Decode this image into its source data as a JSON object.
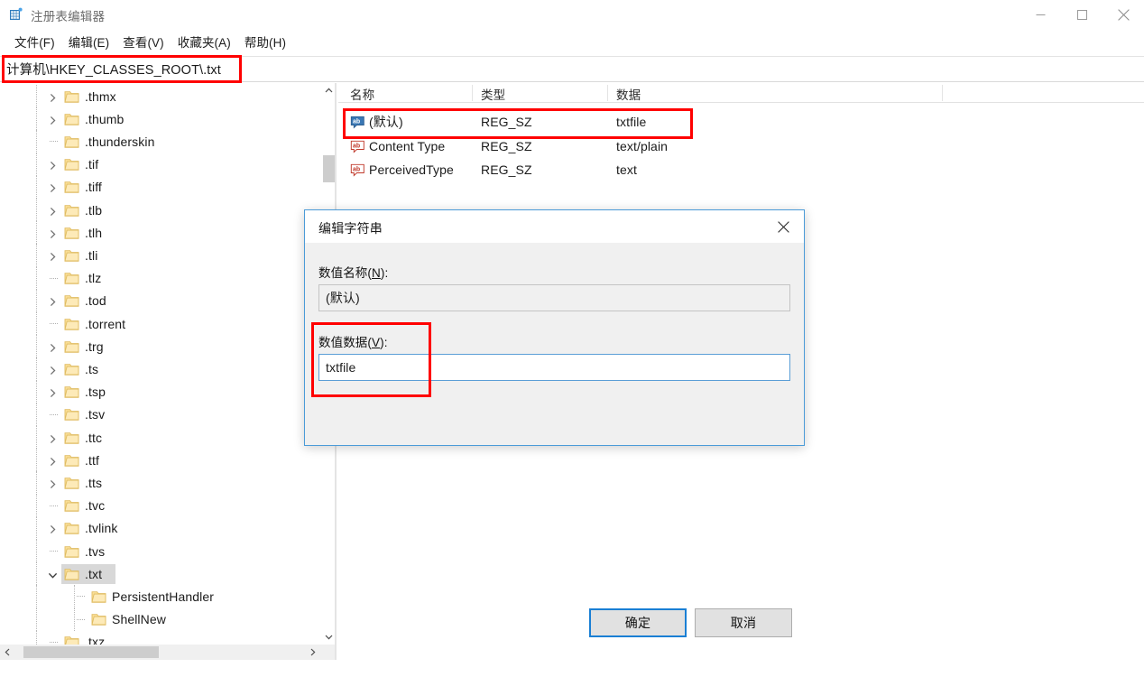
{
  "window": {
    "title": "注册表编辑器",
    "icon": "registry-editor-icon",
    "controls": {
      "minimize": "最小化",
      "maximize": "最大化",
      "close": "关闭"
    }
  },
  "menubar": {
    "items": [
      {
        "label": "文件(F)",
        "name": "menu-file"
      },
      {
        "label": "编辑(E)",
        "name": "menu-edit"
      },
      {
        "label": "查看(V)",
        "name": "menu-view"
      },
      {
        "label": "收藏夹(A)",
        "name": "menu-favorites"
      },
      {
        "label": "帮助(H)",
        "name": "menu-help"
      }
    ]
  },
  "address_bar": {
    "value": "计算机\\HKEY_CLASSES_ROOT\\.txt",
    "placeholder": "计算机\\HKEY_CLASSES_ROOT\\.txt"
  },
  "tree": {
    "items": [
      {
        "label": ".thmx",
        "expander": "collapsed",
        "depth": 1,
        "selected": false
      },
      {
        "label": ".thumb",
        "expander": "collapsed",
        "depth": 1,
        "selected": false
      },
      {
        "label": ".thunderskin",
        "expander": "leaf",
        "depth": 1,
        "selected": false
      },
      {
        "label": ".tif",
        "expander": "collapsed",
        "depth": 1,
        "selected": false
      },
      {
        "label": ".tiff",
        "expander": "collapsed",
        "depth": 1,
        "selected": false
      },
      {
        "label": ".tlb",
        "expander": "collapsed",
        "depth": 1,
        "selected": false
      },
      {
        "label": ".tlh",
        "expander": "collapsed",
        "depth": 1,
        "selected": false
      },
      {
        "label": ".tli",
        "expander": "collapsed",
        "depth": 1,
        "selected": false
      },
      {
        "label": ".tlz",
        "expander": "leaf",
        "depth": 1,
        "selected": false
      },
      {
        "label": ".tod",
        "expander": "collapsed",
        "depth": 1,
        "selected": false
      },
      {
        "label": ".torrent",
        "expander": "leaf",
        "depth": 1,
        "selected": false
      },
      {
        "label": ".trg",
        "expander": "collapsed",
        "depth": 1,
        "selected": false
      },
      {
        "label": ".ts",
        "expander": "collapsed",
        "depth": 1,
        "selected": false
      },
      {
        "label": ".tsp",
        "expander": "collapsed",
        "depth": 1,
        "selected": false
      },
      {
        "label": ".tsv",
        "expander": "leaf",
        "depth": 1,
        "selected": false
      },
      {
        "label": ".ttc",
        "expander": "collapsed",
        "depth": 1,
        "selected": false
      },
      {
        "label": ".ttf",
        "expander": "collapsed",
        "depth": 1,
        "selected": false
      },
      {
        "label": ".tts",
        "expander": "collapsed",
        "depth": 1,
        "selected": false
      },
      {
        "label": ".tvc",
        "expander": "leaf",
        "depth": 1,
        "selected": false
      },
      {
        "label": ".tvlink",
        "expander": "collapsed",
        "depth": 1,
        "selected": false
      },
      {
        "label": ".tvs",
        "expander": "leaf",
        "depth": 1,
        "selected": false
      },
      {
        "label": ".txt",
        "expander": "expanded",
        "depth": 1,
        "selected": true
      },
      {
        "label": "PersistentHandler",
        "expander": "leaf",
        "depth": 2,
        "selected": false
      },
      {
        "label": "ShellNew",
        "expander": "leaf",
        "depth": 2,
        "selected": false
      },
      {
        "label": ".txz",
        "expander": "leaf",
        "depth": 1,
        "selected": false
      }
    ],
    "vscrollbar": {
      "up_icon": "chevron-up-icon",
      "down_icon": "chevron-down-icon"
    },
    "hscrollbar": {
      "left_icon": "chevron-left-icon",
      "right_icon": "chevron-right-icon"
    }
  },
  "list": {
    "columns": [
      "名称",
      "类型",
      "数据"
    ],
    "rows": [
      {
        "icon": "string-value-icon",
        "selected": true,
        "name": "(默认)",
        "type": "REG_SZ",
        "data": "txtfile"
      },
      {
        "icon": "string-value-icon",
        "selected": false,
        "name": "Content Type",
        "type": "REG_SZ",
        "data": "text/plain"
      },
      {
        "icon": "string-value-icon",
        "selected": false,
        "name": "PerceivedType",
        "type": "REG_SZ",
        "data": "text"
      }
    ]
  },
  "dialog": {
    "title": "编辑字符串",
    "close_icon": "close-icon",
    "name_label_prefix": "数值名称(",
    "name_label_key": "N",
    "name_label_suffix": "):",
    "name_value": "(默认)",
    "data_label_prefix": "数值数据(",
    "data_label_key": "V",
    "data_label_suffix": "):",
    "data_value": "txtfile",
    "ok_label": "确定",
    "cancel_label": "取消"
  },
  "annotations": {
    "color": "#ff0000",
    "boxes": [
      {
        "name": "annotation-address-bar"
      },
      {
        "name": "annotation-default-value-row"
      },
      {
        "name": "annotation-value-data-field"
      }
    ]
  }
}
